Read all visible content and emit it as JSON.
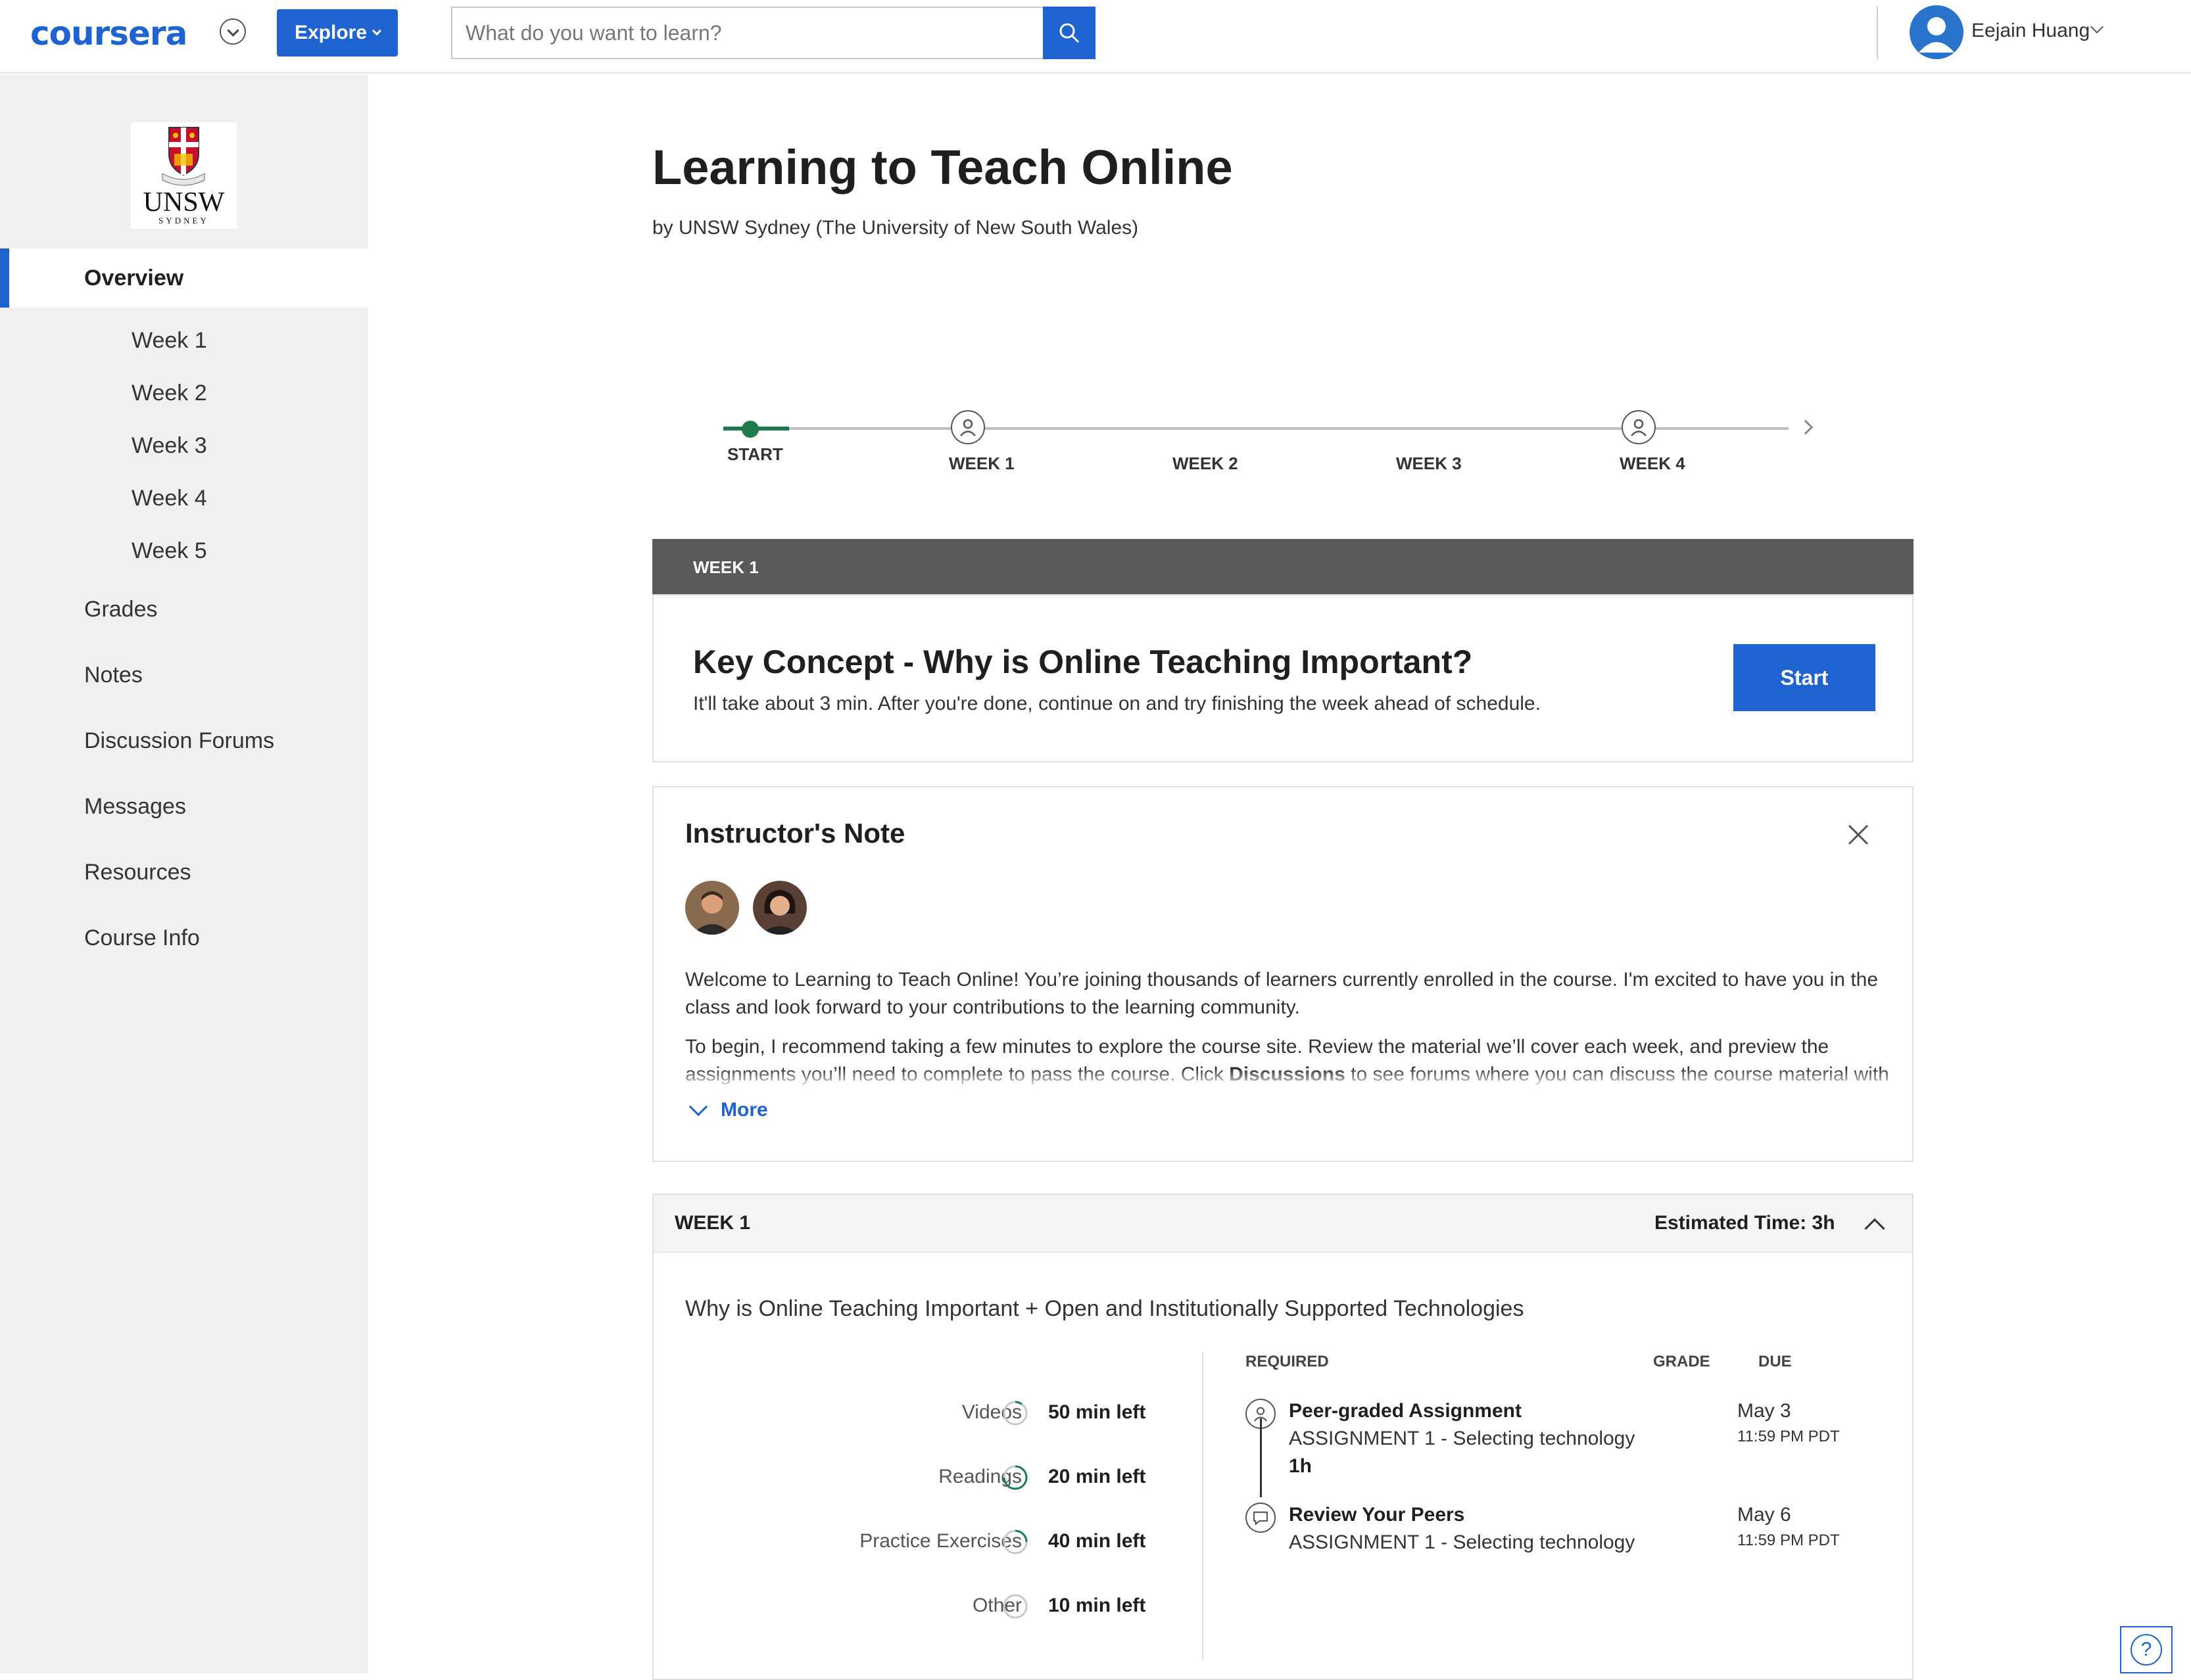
{
  "nav": {
    "logo_text": "coursera",
    "explore_label": "Explore",
    "search_placeholder": "What do you want to learn?",
    "user_name": "Eejain Huang",
    "accent_color": "#1f63d0"
  },
  "sidebar": {
    "university_logo_text": "UNSW",
    "university_logo_subtext": "SYDNEY",
    "items": [
      {
        "label": "Overview",
        "active": true
      },
      {
        "label": "Week 1"
      },
      {
        "label": "Week 2"
      },
      {
        "label": "Week 3"
      },
      {
        "label": "Week 4"
      },
      {
        "label": "Week 5"
      },
      {
        "label": "Grades"
      },
      {
        "label": "Notes"
      },
      {
        "label": "Discussion Forums"
      },
      {
        "label": "Messages"
      },
      {
        "label": "Resources"
      },
      {
        "label": "Course Info"
      }
    ]
  },
  "course": {
    "title": "Learning to Teach Online",
    "subtitle": "by UNSW Sydney (The University of New South Wales)"
  },
  "timeline": {
    "labels": [
      "START",
      "WEEK 1",
      "WEEK 2",
      "WEEK 3",
      "WEEK 4"
    ],
    "progress_color": "#1e7b4e"
  },
  "next_item": {
    "week_label": "WEEK 1",
    "title": "Key Concept - Why is Online Teaching Important?",
    "description": "It'll take about 3 min. After you're done, continue on and try finishing the week ahead of schedule.",
    "button_label": "Start"
  },
  "instructor_note": {
    "title": "Instructor's Note",
    "paragraph_1": "Welcome to Learning to Teach Online! You’re joining thousands of learners currently enrolled in the course. I'm excited to have you in the class and look forward to your contributions to the learning community.",
    "paragraph_2_start": "To begin, I recommend taking a few minutes to explore the course site. Review the material we’ll cover each week, and preview the assignments you’ll need to complete to pass the course. Click ",
    "paragraph_2_bold": "Discussions",
    "paragraph_2_end": " to see forums where you can discuss the course material with",
    "more_label": "More"
  },
  "week_section": {
    "label": "WEEK 1",
    "estimated_time": "Estimated Time: 3h",
    "topic": "Why is Online Teaching Important + Open and Institutionally Supported Technologies",
    "stats": [
      {
        "label": "Videos",
        "value": "50 min left"
      },
      {
        "label": "Readings",
        "value": "20 min left"
      },
      {
        "label": "Practice Exercises",
        "value": "40 min left"
      },
      {
        "label": "Other",
        "value": "10 min left"
      }
    ],
    "columns": {
      "required": "REQUIRED",
      "grade": "GRADE",
      "due": "DUE"
    },
    "assignments": [
      {
        "title": "Peer-graded Assignment",
        "subtitle": "ASSIGNMENT 1 - Selecting technology",
        "duration": "1h",
        "due_date": "May 3",
        "due_time": "11:59 PM PDT"
      },
      {
        "title": "Review Your Peers",
        "subtitle": "ASSIGNMENT 1 - Selecting technology",
        "due_date": "May 6",
        "due_time": "11:59 PM PDT"
      }
    ]
  },
  "help": {
    "label": "?"
  }
}
